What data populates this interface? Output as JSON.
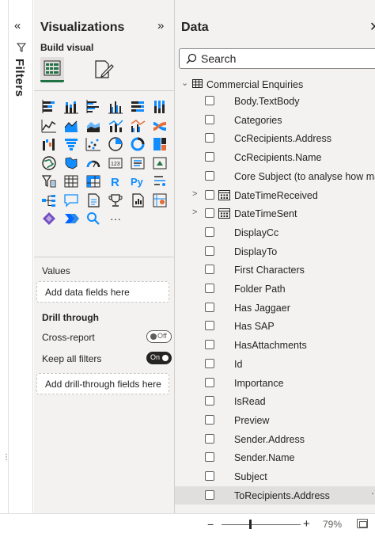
{
  "filters": {
    "label": "Filters",
    "collapse_glyph": "«"
  },
  "visualizations": {
    "title": "Visualizations",
    "expand_glyph": "»",
    "build_visual_label": "Build visual",
    "more_visuals": "···",
    "icons": [
      "stacked-bar-chart-icon",
      "stacked-column-chart-icon",
      "clustered-bar-chart-icon",
      "clustered-column-chart-icon",
      "100-stacked-bar-chart-icon",
      "100-stacked-column-chart-icon",
      "line-chart-icon",
      "area-chart-icon",
      "stacked-area-chart-icon",
      "line-and-stacked-column-icon",
      "line-and-clustered-column-icon",
      "ribbon-chart-icon",
      "waterfall-chart-icon",
      "funnel-chart-icon",
      "scatter-chart-icon",
      "pie-chart-icon",
      "donut-chart-icon",
      "treemap-icon",
      "map-icon",
      "filled-map-icon",
      "gauge-icon",
      "card-icon",
      "multi-row-card-icon",
      "kpi-icon",
      "slicer-icon",
      "table-icon",
      "matrix-icon",
      "r-visual-icon",
      "python-visual-icon",
      "key-influencers-icon",
      "decomposition-tree-icon",
      "qa-icon",
      "smart-narrative-icon",
      "metrics-icon",
      "paginated-report-icon",
      "azure-map-icon",
      "power-apps-icon",
      "power-automate-icon",
      "search-visual-icon"
    ],
    "values_label": "Values",
    "values_placeholder": "Add data fields here",
    "drill_through_label": "Drill through",
    "cross_report": {
      "label": "Cross-report",
      "state": "Off"
    },
    "keep_all_filters": {
      "label": "Keep all filters",
      "state": "On"
    },
    "drill_placeholder": "Add drill-through fields here"
  },
  "data": {
    "title": "Data",
    "close_glyph": "✕",
    "search_placeholder": "Search",
    "table": {
      "name": "Commercial Enquiries",
      "expanded": true
    },
    "fields": [
      {
        "name": "Body.TextBody"
      },
      {
        "name": "Categories"
      },
      {
        "name": "CcRecipients.Address"
      },
      {
        "name": "CcRecipients.Name"
      },
      {
        "name": "Core Subject (to analyse how man"
      },
      {
        "name": "DateTimeReceived",
        "hierarchy": true
      },
      {
        "name": "DateTimeSent",
        "hierarchy": true
      },
      {
        "name": "DisplayCc"
      },
      {
        "name": "DisplayTo"
      },
      {
        "name": "First Characters"
      },
      {
        "name": "Folder Path"
      },
      {
        "name": "Has Jaggaer"
      },
      {
        "name": "Has SAP"
      },
      {
        "name": "HasAttachments"
      },
      {
        "name": "Id"
      },
      {
        "name": "Importance"
      },
      {
        "name": "IsRead"
      },
      {
        "name": "Preview"
      },
      {
        "name": "Sender.Address"
      },
      {
        "name": "Sender.Name"
      },
      {
        "name": "Subject"
      },
      {
        "name": "ToRecipients.Address",
        "highlighted": true
      }
    ]
  },
  "statusbar": {
    "zoom": "79%",
    "zoom_minus": "−",
    "zoom_plus": "+"
  },
  "colors": {
    "accent": "#217346",
    "pane_bg": "#f3f2f1",
    "text": "#252423"
  }
}
